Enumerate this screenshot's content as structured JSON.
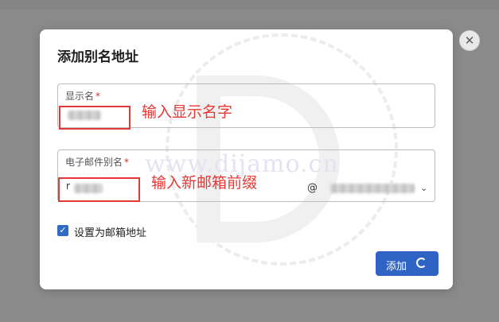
{
  "dialog": {
    "title": "添加别名地址",
    "close_icon": "close-icon",
    "display_name_field": {
      "label": "显示名",
      "required_mark": "*",
      "annotation": "输入显示名字"
    },
    "email_alias_field": {
      "label": "电子邮件别名",
      "required_mark": "*",
      "prefix_char": "r",
      "at_symbol": "@",
      "annotation": "输入新邮箱前缀",
      "dropdown_icon": "chevron-down-icon"
    },
    "set_as_mailbox_address": {
      "label": "设置为邮箱地址",
      "checked": true
    },
    "add_button": {
      "label": "添加",
      "loading_icon": "spinner-icon"
    }
  },
  "watermark": {
    "text": "www.dijamo.cn"
  },
  "colors": {
    "primary": "#2f64c5",
    "annotation_red": "#e53935",
    "overlay": "#8a8a8a"
  }
}
